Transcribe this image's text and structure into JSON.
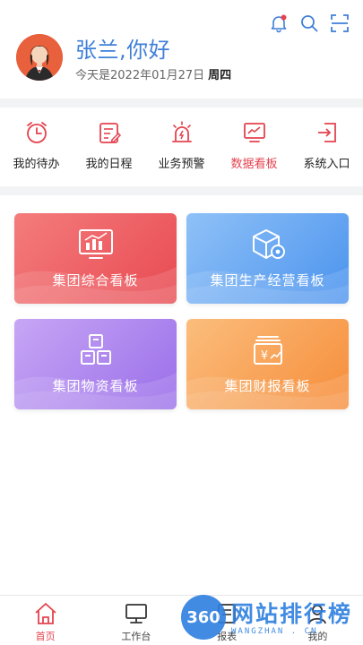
{
  "header": {
    "greeting": "张兰,你好",
    "date_text": "今天是2022年01月27日",
    "weekday": "周四",
    "icons": [
      "bell-icon",
      "search-icon",
      "scan-icon"
    ],
    "bell_badge_color": "#e4434f"
  },
  "shortcuts": [
    {
      "label": "我的待办",
      "icon": "clock-icon",
      "active": false
    },
    {
      "label": "我的日程",
      "icon": "calendar-edit-icon",
      "active": false
    },
    {
      "label": "业务预警",
      "icon": "alarm-icon",
      "active": false
    },
    {
      "label": "数据看板",
      "icon": "monitor-chart-icon",
      "active": true
    },
    {
      "label": "系统入口",
      "icon": "login-icon",
      "active": false
    }
  ],
  "cards": [
    {
      "label": "集团综合看板",
      "icon": "bar-chart-icon",
      "color": "#ee5b62"
    },
    {
      "label": "集团生产经营看板",
      "icon": "box-gear-icon",
      "color": "#5ea0f0"
    },
    {
      "label": "集团物资看板",
      "icon": "boxes-icon",
      "color": "#a77ded"
    },
    {
      "label": "集团财报看板",
      "icon": "money-report-icon",
      "color": "#f89a4a"
    }
  ],
  "bottom_nav": [
    {
      "label": "首页",
      "icon": "home-icon",
      "active": true
    },
    {
      "label": "工作台",
      "icon": "monitor-icon",
      "active": false
    },
    {
      "label": "报表",
      "icon": "report-icon",
      "active": false
    },
    {
      "label": "我的",
      "icon": "user-icon",
      "active": false
    }
  ],
  "watermark": {
    "badge": "360",
    "title": "网站排行榜",
    "subtitle": "WANGZHAN . CN"
  },
  "colors": {
    "accent": "#e4434f",
    "greeting_blue": "#3f7fd9"
  }
}
